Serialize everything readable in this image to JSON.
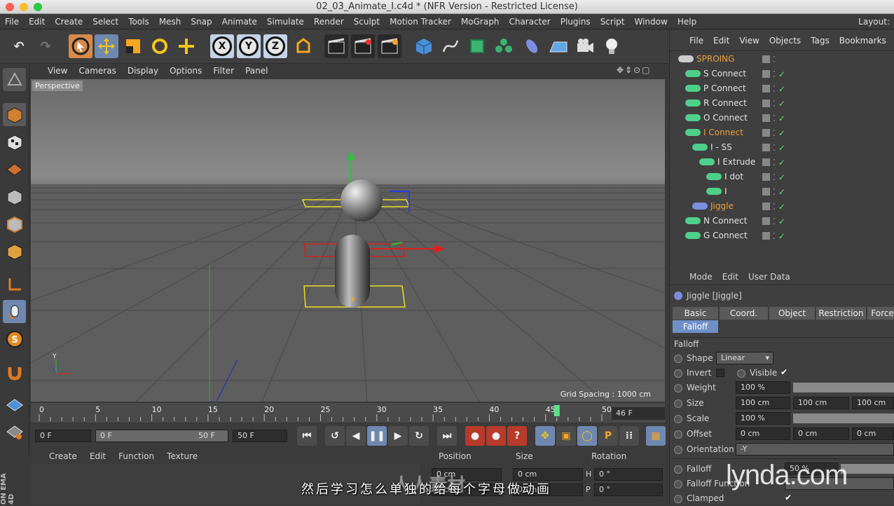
{
  "window": {
    "title": "02_03_Animate_I.c4d * (NFR Version - Restricted License)"
  },
  "menubar": {
    "items": [
      "File",
      "Edit",
      "Create",
      "Select",
      "Tools",
      "Mesh",
      "Snap",
      "Animate",
      "Simulate",
      "Render",
      "Sculpt",
      "Motion Tracker",
      "MoGraph",
      "Character",
      "Plugins",
      "Script",
      "Window",
      "Help"
    ],
    "layout": "Layout:"
  },
  "viewport": {
    "menu": [
      "View",
      "Cameras",
      "Display",
      "Options",
      "Filter",
      "Panel"
    ],
    "camera": "Perspective",
    "grid_spacing": "Grid Spacing : 1000 cm",
    "axis_label": "Y"
  },
  "timeline": {
    "ticks": [
      "0",
      "5",
      "10",
      "15",
      "20",
      "25",
      "30",
      "35",
      "40",
      "45",
      "50"
    ],
    "current_frame": "46 F",
    "playhead_fraction": 0.92
  },
  "transport": {
    "start": "0 F",
    "range_start": "0 F",
    "range_end": "50 F",
    "end": "50 F",
    "keys": {
      "record": "●",
      "auto": "●",
      "question": "?",
      "p": "P"
    }
  },
  "materials": {
    "menu": [
      "Create",
      "Edit",
      "Function",
      "Texture"
    ]
  },
  "coordinates": {
    "headers": [
      "Position",
      "Size",
      "Rotation"
    ],
    "row1": {
      "pos": "0 cm",
      "size": "0 cm",
      "rot_label": "H",
      "rot": "0 °"
    },
    "row2": {
      "pos": "0 cm",
      "size": "0 cm",
      "rot_label": "P",
      "rot": "0 °"
    }
  },
  "objects": {
    "menu": [
      "File",
      "Edit",
      "View",
      "Objects",
      "Tags",
      "Bookmarks"
    ],
    "rows": [
      {
        "name": "SPROING",
        "indent": 0,
        "color": "#e8a040"
      },
      {
        "name": "S Connect",
        "indent": 1,
        "color": "#e2e2e2"
      },
      {
        "name": "P Connect",
        "indent": 1,
        "color": "#e2e2e2"
      },
      {
        "name": "R Connect",
        "indent": 1,
        "color": "#e2e2e2"
      },
      {
        "name": "O Connect",
        "indent": 1,
        "color": "#e2e2e2"
      },
      {
        "name": "I Connect",
        "indent": 1,
        "color": "#e8a040"
      },
      {
        "name": "I - SS",
        "indent": 2,
        "color": "#e2e2e2"
      },
      {
        "name": "I Extrude",
        "indent": 3,
        "color": "#e2e2e2"
      },
      {
        "name": "I dot",
        "indent": 4,
        "color": "#e2e2e2"
      },
      {
        "name": "I",
        "indent": 4,
        "color": "#e2e2e2"
      },
      {
        "name": "Jiggle",
        "indent": 2,
        "color": "#e8a040"
      },
      {
        "name": "N Connect",
        "indent": 1,
        "color": "#e2e2e2"
      },
      {
        "name": "G Connect",
        "indent": 1,
        "color": "#e2e2e2"
      }
    ]
  },
  "attributes": {
    "menu": [
      "Mode",
      "Edit",
      "User Data"
    ],
    "object_title": "Jiggle [Jiggle]",
    "tabs": [
      "Basic",
      "Coord.",
      "Object",
      "Restriction",
      "Force"
    ],
    "active_tab": "Falloff",
    "section": "Falloff",
    "shape_label": "Shape",
    "shape_value": "Linear",
    "invert_label": "Invert",
    "visible_label": "Visible",
    "weight_label": "Weight",
    "weight_value": "100 %",
    "size_label": "Size",
    "size_values": [
      "100 cm",
      "100 cm",
      "100 cm"
    ],
    "scale_label": "Scale",
    "scale_value": "100 %",
    "offset_label": "Offset",
    "offset_values": [
      "0 cm",
      "0 cm",
      "0 cm"
    ],
    "orientation_label": "Orientation",
    "orientation_value": "-Y",
    "falloff_label": "Falloff",
    "falloff_value": "50 %",
    "falloff_function_label": "Falloff Function",
    "clamped_label": "Clamped"
  },
  "overlay": {
    "subtitle": "然后学习怎么单独的给每个字母做动画",
    "brand": "lynda.com",
    "sidebrand": "ON EMA 4D",
    "watermark": "人人素材"
  }
}
